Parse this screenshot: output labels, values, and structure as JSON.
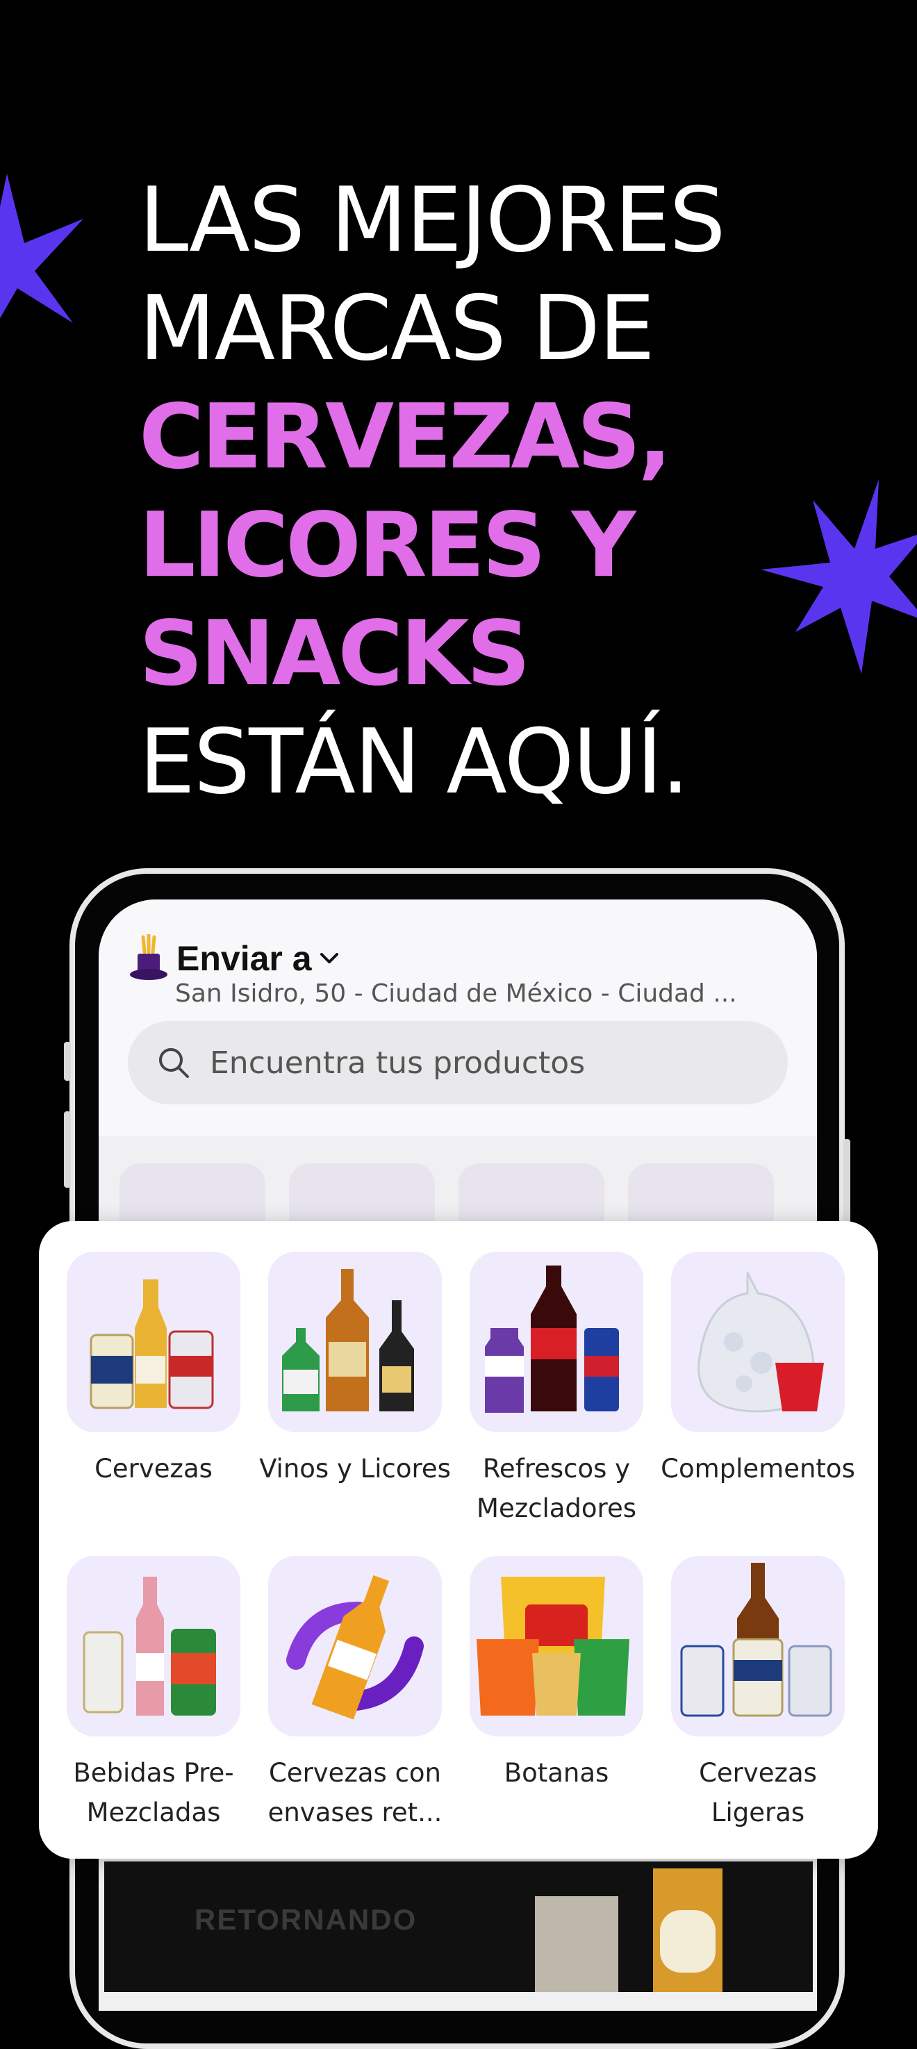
{
  "headline": {
    "line1": "LAS MEJORES",
    "line2": "MARCAS DE",
    "line3": "CERVEZAS,",
    "line4": "LICORES Y",
    "line5": "SNACKS",
    "line6": "ESTÁN AQUÍ."
  },
  "colors": {
    "background": "#000000",
    "accent_pink": "#e06ee8",
    "accent_purple": "#5a35f0",
    "tile_bg": "#efeafc"
  },
  "app": {
    "delivery_label": "Enviar a",
    "address": "San Isidro, 50 - Ciudad de México - Ciudad ...",
    "search_placeholder": "Encuentra tus productos",
    "icons": [
      "magic-hat-icon",
      "chevron-down-icon",
      "search-icon"
    ]
  },
  "categories": [
    {
      "label": "Cervezas",
      "icon": "beer-cans-image"
    },
    {
      "label": "Vinos y Licores",
      "icon": "liquor-bottles-image"
    },
    {
      "label": "Refrescos y Mezcladores",
      "icon": "soda-bottles-image"
    },
    {
      "label": "Complementos",
      "icon": "ice-bag-cup-image"
    },
    {
      "label": "Bebidas Pre-Mezcladas",
      "icon": "premixed-cans-image"
    },
    {
      "label": "Cervezas con envases ret...",
      "icon": "returnable-bottle-image"
    },
    {
      "label": "Botanas",
      "icon": "snack-bags-image"
    },
    {
      "label": "Cervezas Ligeras",
      "icon": "light-beer-image"
    }
  ],
  "bottom_peek": {
    "text": "RETORNANDO"
  }
}
